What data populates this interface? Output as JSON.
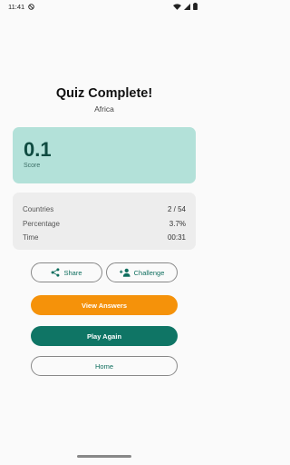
{
  "status_bar": {
    "time": "11:41",
    "icons": [
      "dnd-icon",
      "wifi-icon",
      "signal-icon",
      "battery-icon"
    ]
  },
  "header": {
    "title": "Quiz Complete!",
    "subtitle": "Africa"
  },
  "score": {
    "value": "0.1",
    "label": "Score"
  },
  "stats": [
    {
      "label": "Countries",
      "value": "2 / 54"
    },
    {
      "label": "Percentage",
      "value": "3.7%"
    },
    {
      "label": "Time",
      "value": "00:31"
    }
  ],
  "actions": {
    "share_label": "Share",
    "challenge_label": "Challenge",
    "view_answers_label": "View Answers",
    "play_again_label": "Play Again",
    "home_label": "Home"
  },
  "colors": {
    "score_card_bg": "#b3e1d9",
    "accent_orange": "#f5920a",
    "accent_green": "#0f7565"
  }
}
